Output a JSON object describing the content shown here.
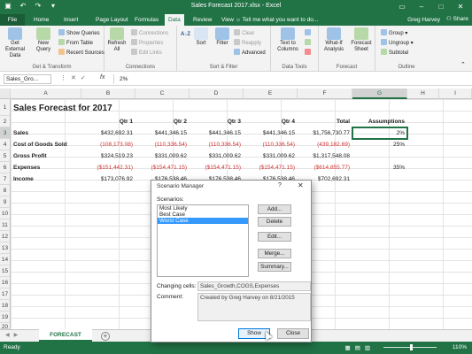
{
  "app": {
    "title": "Sales Forecast 2017.xlsx - Excel",
    "user": "Greg Harvey",
    "share_label": "Share",
    "tell_me": "Tell me what you want to do...",
    "accent_color": "#217346"
  },
  "qat": [
    "save-icon",
    "undo-icon",
    "redo-icon",
    "customize-icon"
  ],
  "tabs": [
    {
      "label": "File"
    },
    {
      "label": "Home"
    },
    {
      "label": "Insert"
    },
    {
      "label": "Page Layout"
    },
    {
      "label": "Formulas"
    },
    {
      "label": "Data"
    },
    {
      "label": "Review"
    },
    {
      "label": "View"
    }
  ],
  "ribbon": {
    "get_external": "Get External Data",
    "new_query": "New Query",
    "show_queries": "Show Queries",
    "from_table": "From Table",
    "recent_sources": "Recent Sources",
    "group_get_transform": "Get & Transform",
    "refresh_all": "Refresh All",
    "connections": "Connections",
    "properties": "Properties",
    "edit_links": "Edit Links",
    "group_connections": "Connections",
    "sort_az": "A↓Z",
    "sort": "Sort",
    "filter": "Filter",
    "clear": "Clear",
    "reapply": "Reapply",
    "advanced": "Advanced",
    "group_sort_filter": "Sort & Filter",
    "text_to_columns": "Text to Columns",
    "group_data_tools": "Data Tools",
    "what_if": "What-If Analysis",
    "forecast_sheet": "Forecast Sheet",
    "group_forecast": "Forecast",
    "group_btn": "Group",
    "ungroup_btn": "Ungroup",
    "subtotal": "Subtotal",
    "group_outline": "Outline"
  },
  "formula_bar": {
    "name_box": "Sales_Gro...",
    "formula": "2%",
    "fx": "fx"
  },
  "columns": [
    "A",
    "B",
    "C",
    "D",
    "E",
    "F",
    "G",
    "H",
    "I"
  ],
  "rows": [
    "1",
    "2",
    "3",
    "4",
    "5",
    "6",
    "7",
    "8",
    "9",
    "10",
    "11",
    "12",
    "13",
    "14",
    "15",
    "16",
    "17",
    "18",
    "19",
    "20"
  ],
  "sheet": {
    "title": "Sales Forecast for 2017",
    "headers": [
      "Qtr 1",
      "Qtr 2",
      "Qtr 3",
      "Qtr 4",
      "Total",
      "Assumptions"
    ],
    "rows": [
      {
        "label": "Sales",
        "values": [
          "$432,692.31",
          "$441,346.15",
          "$441,346.15",
          "$441,346.15",
          "$1,756,730.77"
        ],
        "assumption": "2%",
        "neg": false
      },
      {
        "label": "Cost of Goods Sold",
        "values": [
          "(108,173.08)",
          "(110,336.54)",
          "(110,336.54)",
          "(110,336.54)",
          "(439,182.69)"
        ],
        "assumption": "25%",
        "neg": true
      },
      {
        "label": "Gross Profit",
        "values": [
          "$324,519.23",
          "$331,009.62",
          "$331,009.62",
          "$331,009.62",
          "$1,317,548.08"
        ],
        "assumption": "",
        "neg": false
      },
      {
        "label": "Expenses",
        "values": [
          "($151,442.31)",
          "($154,471.15)",
          "($154,471.15)",
          "($154,471.15)",
          "($614,855.77)"
        ],
        "assumption": "35%",
        "neg": true
      },
      {
        "label": "Income",
        "values": [
          "$173,076.92",
          "$176,538.46",
          "$176,538.46",
          "$176,538.46",
          "$702,692.31"
        ],
        "assumption": "",
        "neg": false
      }
    ]
  },
  "sheet_tabs": {
    "active": "FORECAST",
    "add_label": "+"
  },
  "status": {
    "ready": "Ready",
    "zoom": "110%"
  },
  "dialog": {
    "title": "Scenario Manager",
    "help": "?",
    "close": "✕",
    "scenarios_label": "Scenarios:",
    "scenarios": [
      {
        "name": "Most Likely",
        "selected": false
      },
      {
        "name": "Best Case",
        "selected": false
      },
      {
        "name": "Worst Case",
        "selected": true
      }
    ],
    "add": "Add...",
    "delete": "Delete",
    "edit": "Edit...",
    "merge": "Merge...",
    "summary": "Summary...",
    "changing_cells_label": "Changing cells:",
    "changing_cells": "Sales_Growth,COGS,Expenses",
    "comment_label": "Comment:",
    "comment": "Created by Greg Harvey on 8/21/2015",
    "show": "Show",
    "close_btn": "Close"
  }
}
